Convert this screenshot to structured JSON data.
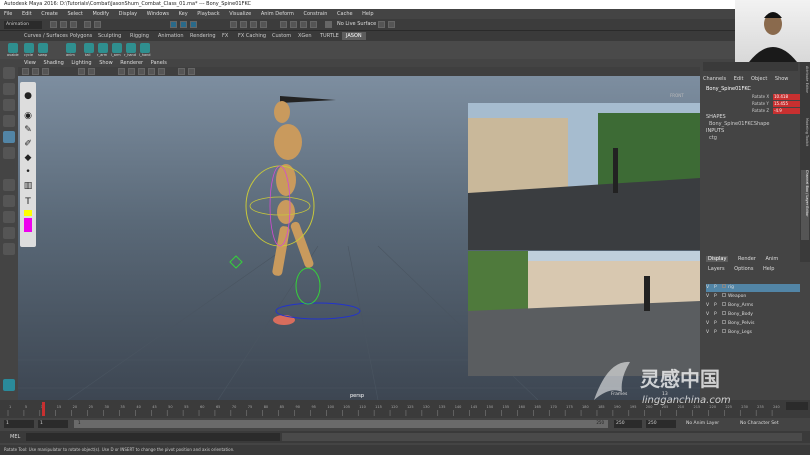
{
  "window": {
    "title": "Autodesk Maya 2016: D:\\Tutorials\\Combat\\JasonShum_Combat_Class_01.ma*  ---  Bony_Spine01FKC"
  },
  "menubar": {
    "items": [
      "File",
      "Edit",
      "Create",
      "Select",
      "Modify",
      "Display",
      "Windows",
      "Key",
      "Playback",
      "Visualize",
      "Anim Deform",
      "Constrain",
      "Cache",
      "Help"
    ]
  },
  "statusline": {
    "mode": "Animation",
    "live_surface": "No Live Surface"
  },
  "shelf": {
    "tabs": [
      "Curves / Surfaces",
      "Polygons",
      "Sculpting",
      "Rigging",
      "Animation",
      "Rendering",
      "FX",
      "FX Caching",
      "Custom",
      "XGen",
      "TURTLE",
      "JASON"
    ],
    "active_tab": "JASON",
    "buttons": [
      "ovable",
      "cycle",
      "swap",
      "anim",
      "tail",
      "r_arm",
      "l_arm",
      "r_hand",
      "l_hand"
    ]
  },
  "viewport": {
    "menus": [
      "View",
      "Shading",
      "Lighting",
      "Show",
      "Renderer",
      "Panels"
    ],
    "camera_label": "persp",
    "view_cube": "FRONT",
    "frames_label": "Frames",
    "frame_number": "13"
  },
  "channelbox": {
    "tabs": [
      "Channels",
      "Edit",
      "Object",
      "Show"
    ],
    "object_name": "Bony_Spine01FKC",
    "attributes": [
      {
        "label": "Rotate X",
        "value": "10.418"
      },
      {
        "label": "Rotate Y",
        "value": "15.455"
      },
      {
        "label": "Rotate Z",
        "value": "-4.9"
      }
    ],
    "shapes_header": "SHAPES",
    "shape_name": "Bony_Spine01FKCShape",
    "inputs_header": "INPUTS",
    "input_name": "ctg"
  },
  "layer_editor": {
    "tabs": [
      "Display",
      "Render",
      "Anim"
    ],
    "active_tab": "Display",
    "menus": [
      "Layers",
      "Options",
      "Help"
    ],
    "layers": [
      {
        "v": "V",
        "p": "P",
        "name": "rig"
      },
      {
        "v": "V",
        "p": "P",
        "name": "Weapon"
      },
      {
        "v": "V",
        "p": "P",
        "name": "Bony_Arms"
      },
      {
        "v": "V",
        "p": "P",
        "name": "Bony_Body"
      },
      {
        "v": "V",
        "p": "P",
        "name": "Bony_Pelvis"
      },
      {
        "v": "V",
        "p": "P",
        "name": "Bony_Legs"
      }
    ]
  },
  "side_tabs": [
    "Attribute Editor",
    "Modeling Toolkit",
    "Channel Box / Layer Editor"
  ],
  "timeline": {
    "ticks": [
      "1",
      "5",
      "10",
      "15",
      "20",
      "25",
      "30",
      "35",
      "40",
      "45",
      "50",
      "55",
      "60",
      "65",
      "70",
      "75",
      "80",
      "85",
      "90",
      "95",
      "100",
      "105",
      "110",
      "115",
      "120",
      "125",
      "130",
      "135",
      "140",
      "145",
      "150",
      "155",
      "160",
      "165",
      "170",
      "175",
      "180",
      "185",
      "190",
      "195",
      "200",
      "205",
      "210",
      "215",
      "220",
      "225",
      "230",
      "235",
      "240"
    ],
    "current_frame": "13"
  },
  "range": {
    "start": "1",
    "start2": "1",
    "slider_start": "1",
    "slider_end": "250",
    "end": "250",
    "end2": "250",
    "anim_layer": "No Anim Layer",
    "char_set": "No Character Set"
  },
  "cmdline": {
    "label": "MEL"
  },
  "helpline": {
    "text": "Rotate Tool: Use manipulator to rotate object(s). Use D or INSERT to change the pivot position and axis orientation."
  },
  "watermark": {
    "chinese": "灵感中国",
    "url": "lingganchina.com"
  },
  "colors": {
    "active_shelf_tab": "#5d5d5d",
    "attr_highlight": "#c83030",
    "selected_layer": "#5285a6"
  }
}
